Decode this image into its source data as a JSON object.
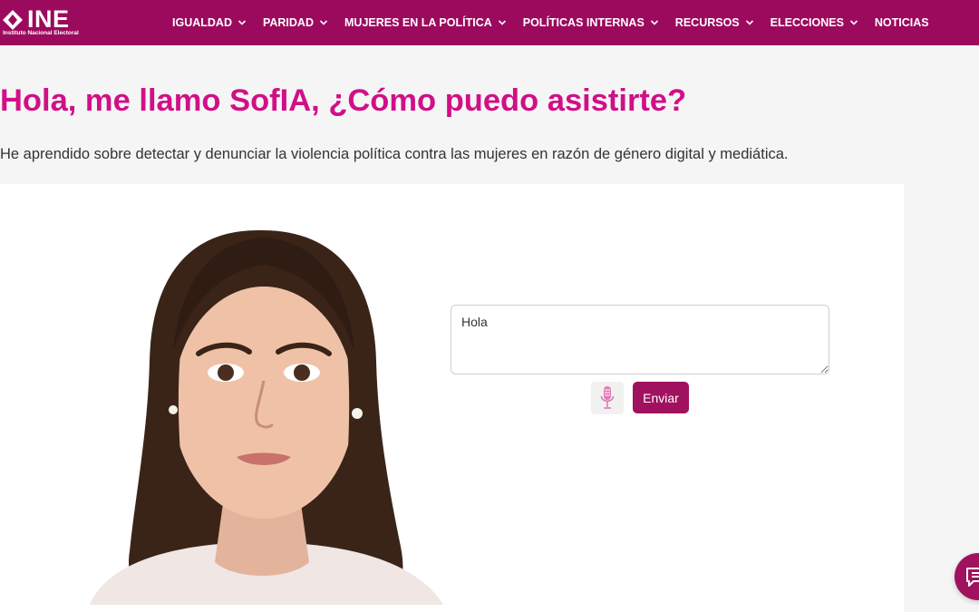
{
  "brand": {
    "logo_text": "INE",
    "logo_subtitle": "Instituto Nacional Electoral"
  },
  "nav": {
    "items": [
      {
        "label": "IGUALDAD",
        "has_dropdown": true
      },
      {
        "label": "PARIDAD",
        "has_dropdown": true
      },
      {
        "label": "MUJERES EN LA POLÍTICA",
        "has_dropdown": true
      },
      {
        "label": "POLÍTICAS INTERNAS",
        "has_dropdown": true
      },
      {
        "label": "RECURSOS",
        "has_dropdown": true
      },
      {
        "label": "ELECCIONES",
        "has_dropdown": true
      },
      {
        "label": "NOTICIAS",
        "has_dropdown": false
      }
    ]
  },
  "page": {
    "title": "Hola, me llamo SofIA, ¿Cómo puedo asistirte?",
    "subtitle": "He aprendido sobre detectar y denunciar la violencia política contra las mujeres en razón de género digital y mediática."
  },
  "chat": {
    "input_value": "Hola",
    "send_label": "Enviar",
    "mic_icon": "microphone-icon",
    "fab_icon": "chat-icon"
  },
  "colors": {
    "header_bg": "#9c0a5e",
    "title_pink": "#d10f87",
    "button_bg": "#a0125f",
    "page_bg": "#f5f5f5"
  }
}
